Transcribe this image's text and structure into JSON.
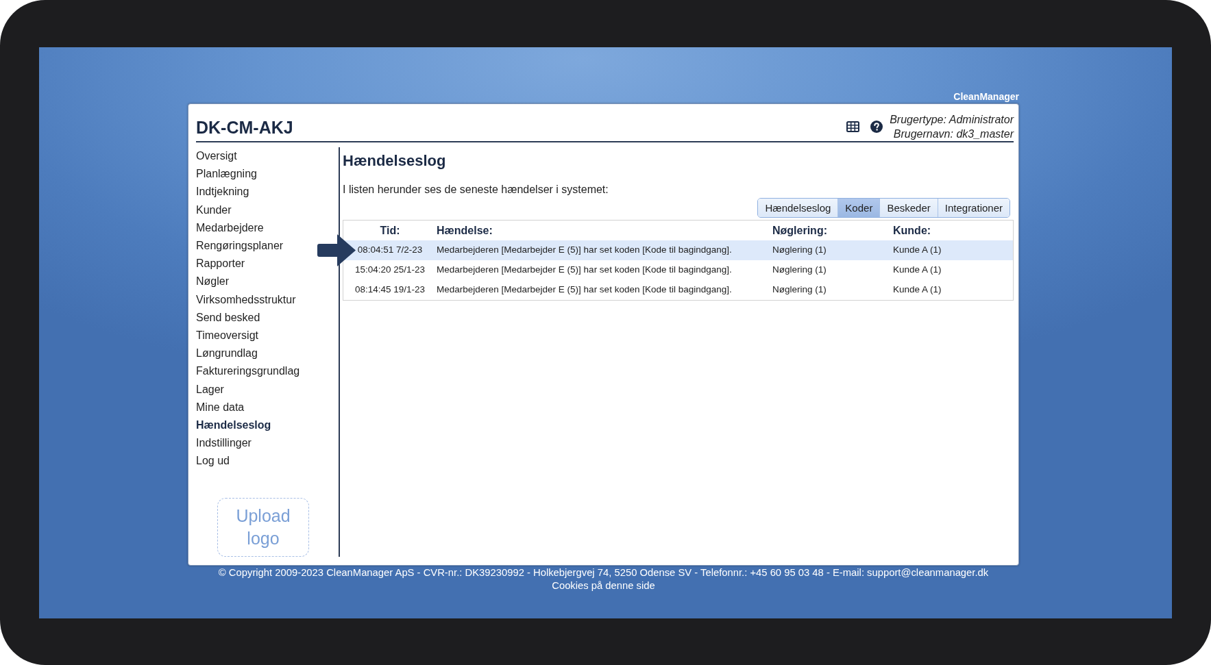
{
  "brand_label": "CleanManager",
  "header": {
    "title": "DK-CM-AKJ",
    "user_type": "Brugertype: Administrator",
    "user_name": "Brugernavn: dk3_master"
  },
  "sidebar": {
    "items": [
      {
        "label": "Oversigt",
        "selected": false
      },
      {
        "label": "Planlægning",
        "selected": false
      },
      {
        "label": "Indtjekning",
        "selected": false
      },
      {
        "label": "Kunder",
        "selected": false
      },
      {
        "label": "Medarbejdere",
        "selected": false
      },
      {
        "label": "Rengøringsplaner",
        "selected": false
      },
      {
        "label": "Rapporter",
        "selected": false
      },
      {
        "label": "Nøgler",
        "selected": false
      },
      {
        "label": "Virksomhedsstruktur",
        "selected": false
      },
      {
        "label": "Send besked",
        "selected": false
      },
      {
        "label": "Timeoversigt",
        "selected": false
      },
      {
        "label": "Løngrundlag",
        "selected": false
      },
      {
        "label": "Faktureringsgrundlag",
        "selected": false
      },
      {
        "label": "Lager",
        "selected": false
      },
      {
        "label": "Mine data",
        "selected": false
      },
      {
        "label": "Hændelseslog",
        "selected": true
      },
      {
        "label": "Indstillinger",
        "selected": false
      },
      {
        "label": "Log ud",
        "selected": false
      }
    ],
    "upload_logo": "Upload logo"
  },
  "main": {
    "title": "Hændelseslog",
    "intro": "I listen herunder ses de seneste hændelser i systemet:",
    "tabs": [
      {
        "label": "Hændelseslog",
        "selected": false
      },
      {
        "label": "Koder",
        "selected": true
      },
      {
        "label": "Beskeder",
        "selected": false
      },
      {
        "label": "Integrationer",
        "selected": false
      }
    ],
    "table": {
      "columns": [
        "Tid:",
        "Hændelse:",
        "Nøglering:",
        "Kunde:"
      ],
      "rows": [
        {
          "selected": true,
          "cells": [
            "08:04:51 7/2-23",
            "Medarbejderen [Medarbejder E (5)] har set koden [Kode til bagindgang].",
            "Nøglering (1)",
            "Kunde A (1)"
          ]
        },
        {
          "selected": false,
          "cells": [
            "15:04:20 25/1-23",
            "Medarbejderen [Medarbejder E (5)] har set koden [Kode til bagindgang].",
            "Nøglering (1)",
            "Kunde A (1)"
          ]
        },
        {
          "selected": false,
          "cells": [
            "08:14:45 19/1-23",
            "Medarbejderen [Medarbejder E (5)] har set koden [Kode til bagindgang].",
            "Nøglering (1)",
            "Kunde A (1)"
          ]
        }
      ]
    }
  },
  "footer": {
    "copyright": "© Copyright 2009-2023 CleanManager ApS - CVR-nr.: DK39230992 - Holkebjergvej 74, 5250 Odense SV - Telefonnr.: +45 60 95 03 48 - E-mail: support@cleanmanager.dk",
    "cookies_link": "Cookies på denne side"
  }
}
